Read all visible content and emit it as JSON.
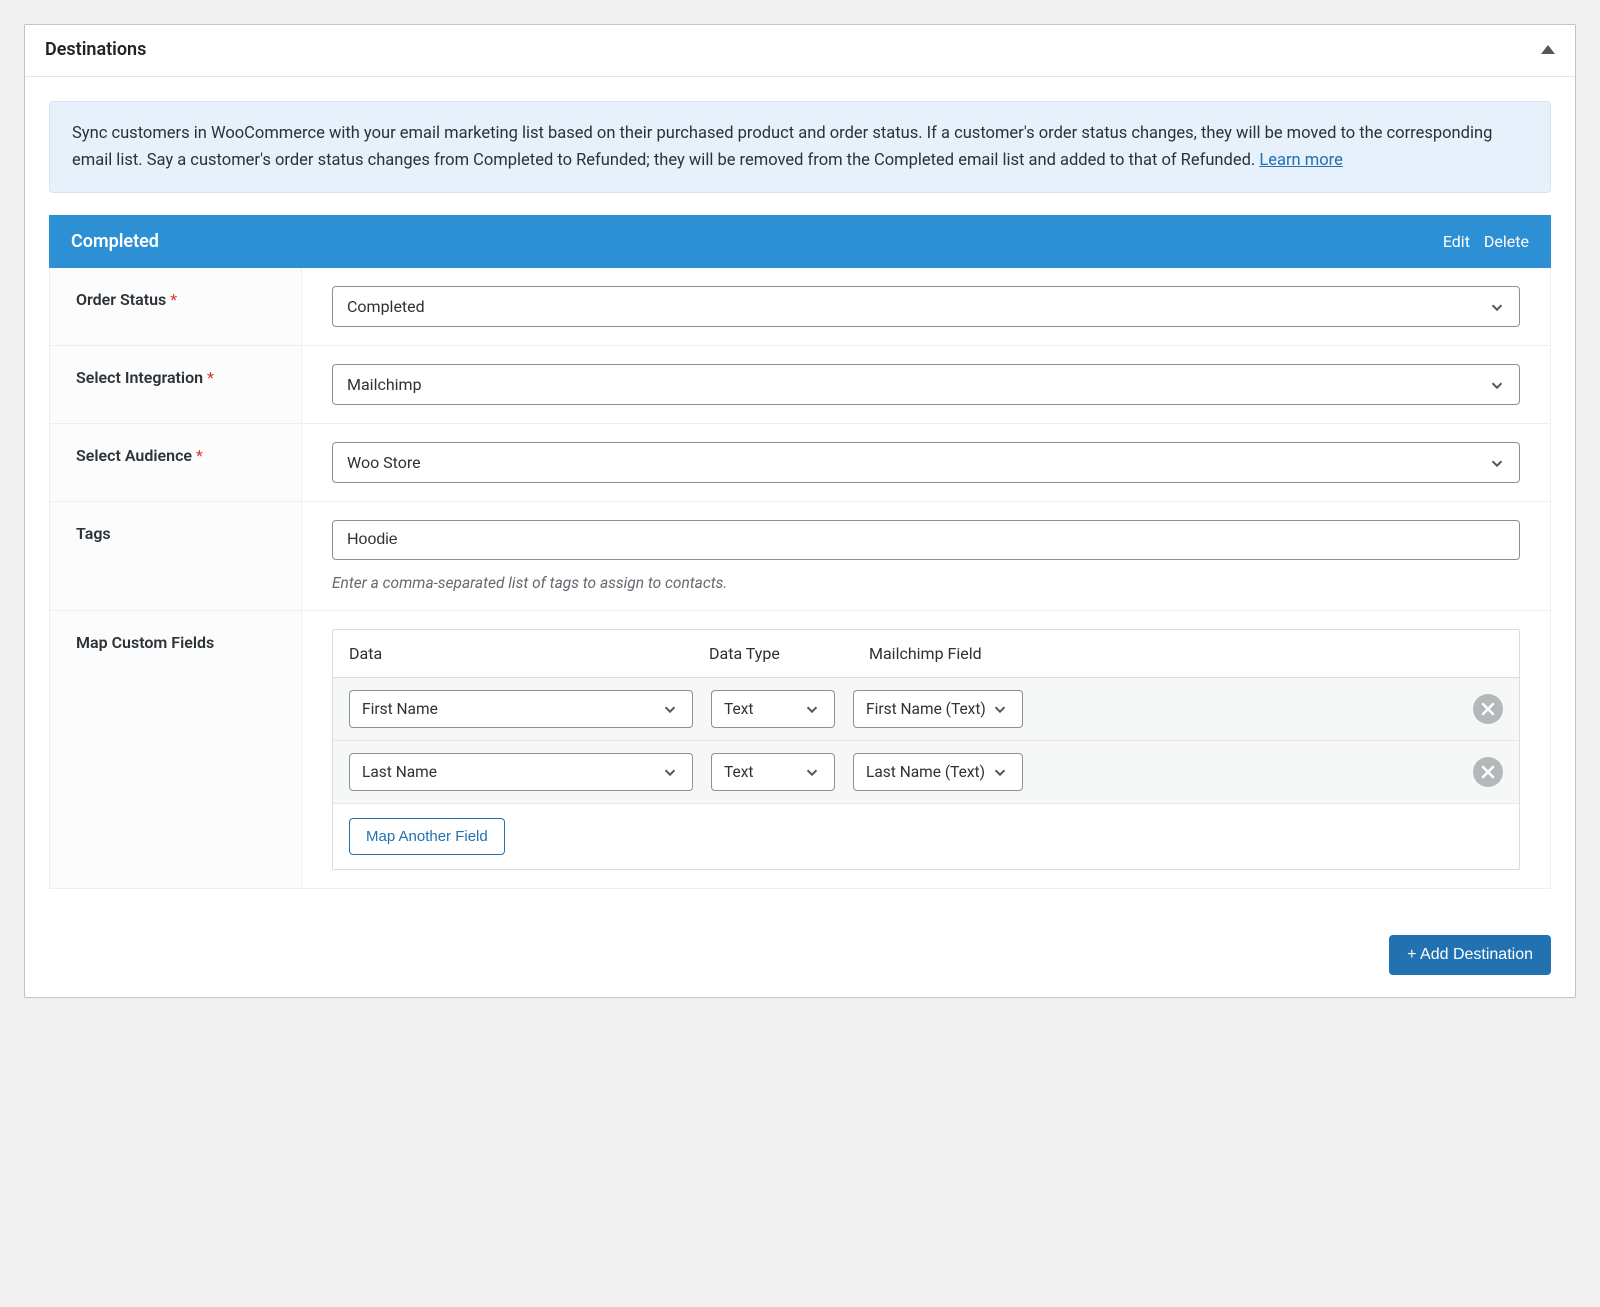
{
  "panel": {
    "title": "Destinations"
  },
  "info": {
    "text": "Sync customers in WooCommerce with your email marketing list based on their purchased product and order status. If a customer's order status changes, they will be moved to the corresponding email list. Say a customer's order status changes from Completed to Refunded; they will be removed from the Completed email list and added to that of Refunded. ",
    "link_label": "Learn more"
  },
  "destination": {
    "title": "Completed",
    "edit_label": "Edit",
    "delete_label": "Delete",
    "fields": {
      "order_status": {
        "label": "Order Status",
        "value": "Completed",
        "required": true
      },
      "integration": {
        "label": "Select Integration",
        "value": "Mailchimp",
        "required": true
      },
      "audience": {
        "label": "Select Audience",
        "value": "Woo Store",
        "required": true
      },
      "tags": {
        "label": "Tags",
        "value": "Hoodie",
        "helper": "Enter a comma-separated list of tags to assign to contacts."
      },
      "map": {
        "label": "Map Custom Fields",
        "headers": {
          "data": "Data",
          "type": "Data Type",
          "field": "Mailchimp Field"
        },
        "rows": [
          {
            "data": "First Name",
            "type": "Text",
            "field": "First Name (Text)"
          },
          {
            "data": "Last Name",
            "type": "Text",
            "field": "Last Name (Text)"
          }
        ],
        "add_label": "Map Another Field"
      }
    }
  },
  "footer": {
    "add_label": "+ Add Destination"
  }
}
